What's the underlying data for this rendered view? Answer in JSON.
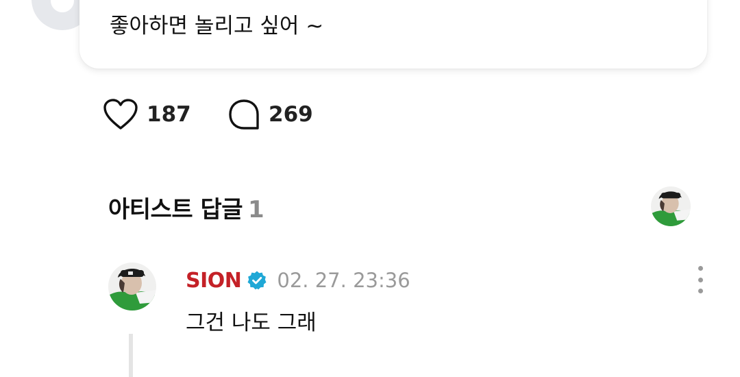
{
  "post": {
    "text": "좋아하면 놀리고 싶어 ~"
  },
  "stats": {
    "like_count": "187",
    "comment_count": "269"
  },
  "section": {
    "title": "아티스트 답글",
    "count": "1"
  },
  "reply": {
    "author": "SION",
    "timestamp": "02. 27. 23:36",
    "text": "그건 나도 그래"
  },
  "icons": {
    "like": "heart-icon",
    "comment": "comment-bubble-icon",
    "verified": "verified-badge-icon",
    "more": "more-vertical-icon"
  },
  "colors": {
    "author": "#c42127",
    "verified": "#1fa8d6",
    "muted": "#9a9a9a",
    "avatar_green": "#3a9a3a"
  }
}
